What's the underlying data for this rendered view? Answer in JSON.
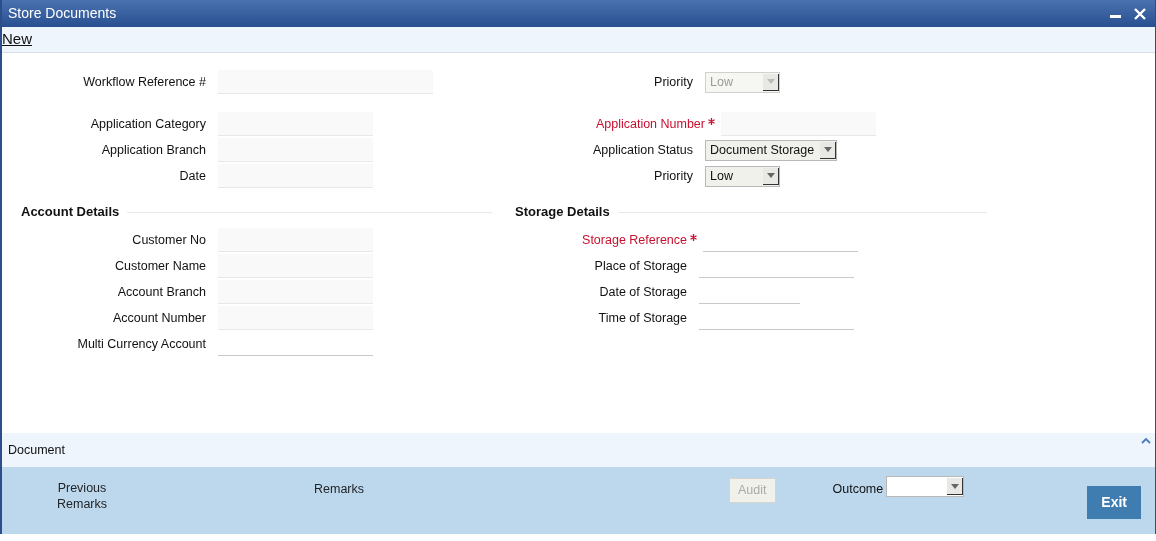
{
  "window": {
    "title": "Store Documents"
  },
  "toolbar": [
    {
      "label": "New"
    }
  ],
  "header": {
    "left": [
      {
        "label": "Workflow Reference #",
        "kind": "text",
        "required": false,
        "disabled": false
      },
      {
        "label": "Application Category",
        "kind": "text",
        "required": false,
        "disabled": false
      },
      {
        "label": "Application Branch",
        "kind": "text",
        "required": false,
        "disabled": false
      },
      {
        "label": "Date",
        "kind": "text",
        "required": false,
        "disabled": false
      }
    ],
    "right": [
      {
        "label": "Priority",
        "kind": "select",
        "value": "Low",
        "required": false,
        "disabled": true
      },
      {
        "label": "Application Number",
        "kind": "text",
        "required": true,
        "disabled": false
      },
      {
        "label": "Application Status",
        "kind": "select",
        "value": "Document Storage",
        "required": false,
        "disabled": false
      },
      {
        "label": "Priority",
        "kind": "select",
        "value": "Low",
        "required": false,
        "disabled": false
      }
    ]
  },
  "sections": [
    {
      "title": "Account Details",
      "fields": [
        {
          "label": "Customer No",
          "kind": "text",
          "required": false,
          "disabled": false
        },
        {
          "label": "Customer Name",
          "kind": "text",
          "required": false,
          "disabled": false
        },
        {
          "label": "Account Branch",
          "kind": "text",
          "required": false,
          "disabled": false
        },
        {
          "label": "Account Number",
          "kind": "text",
          "required": false,
          "disabled": false
        },
        {
          "label": "Multi Currency Account",
          "kind": "underline",
          "required": false,
          "disabled": false
        }
      ]
    },
    {
      "title": "Storage Details",
      "fields": [
        {
          "label": "Storage Reference",
          "kind": "underline",
          "required": true,
          "disabled": false
        },
        {
          "label": "Place of Storage",
          "kind": "underline",
          "required": false,
          "disabled": false
        },
        {
          "label": "Date of Storage",
          "kind": "underline",
          "required": false,
          "disabled": false
        },
        {
          "label": "Time of Storage",
          "kind": "underline",
          "required": false,
          "disabled": false
        }
      ]
    }
  ],
  "document_bar": {
    "label": "Document"
  },
  "footer": {
    "previous_remarks": "Previous Remarks",
    "remarks": "Remarks",
    "audit": {
      "label": "Audit",
      "disabled": true
    },
    "outcome": {
      "label": "Outcome"
    },
    "exit": {
      "label": "Exit"
    }
  }
}
